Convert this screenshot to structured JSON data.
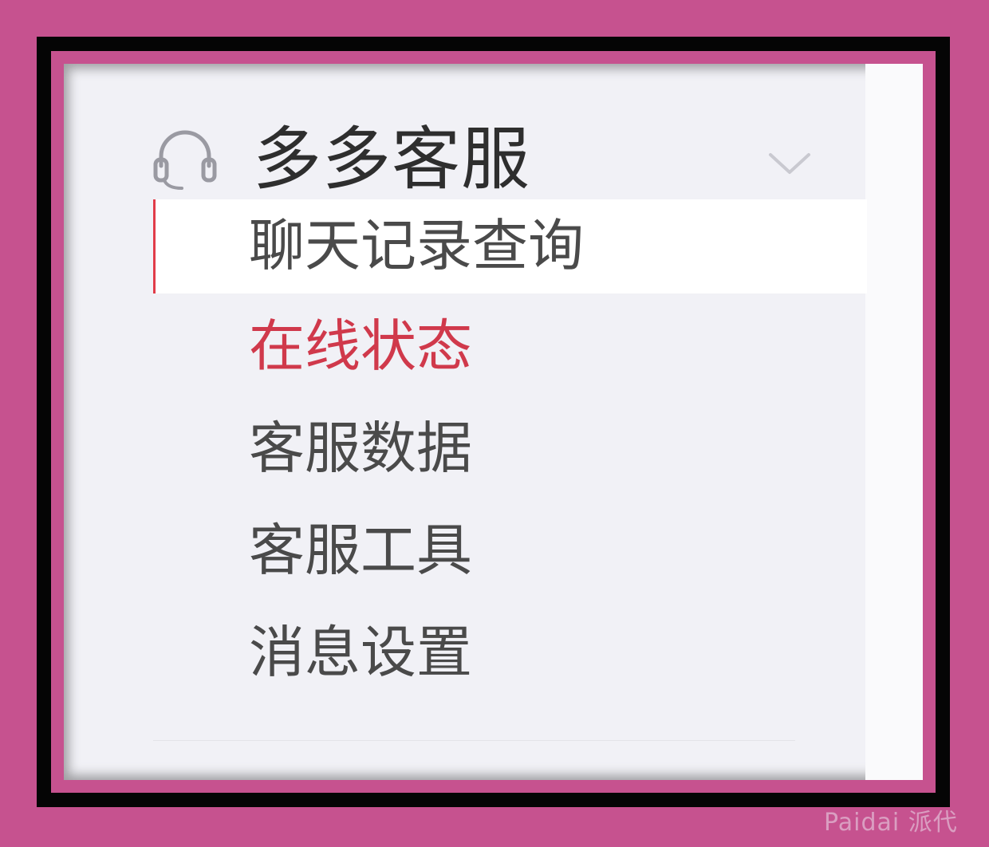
{
  "menu": {
    "title": "多多客服",
    "icon": "headset-icon",
    "expand_icon": "chevron-down-icon",
    "items": [
      {
        "label": "聊天记录查询",
        "state": "active"
      },
      {
        "label": "在线状态",
        "state": "hover"
      },
      {
        "label": "客服数据",
        "state": "normal"
      },
      {
        "label": "客服工具",
        "state": "normal"
      },
      {
        "label": "消息设置",
        "state": "normal"
      }
    ]
  },
  "watermark": "Paidai 派代",
  "colors": {
    "accent": "#e13c49",
    "hover_text": "#d0394b",
    "panel_bg": "#f1f1f6",
    "active_bg": "#ffffff",
    "frame_pink": "#c6528f"
  }
}
